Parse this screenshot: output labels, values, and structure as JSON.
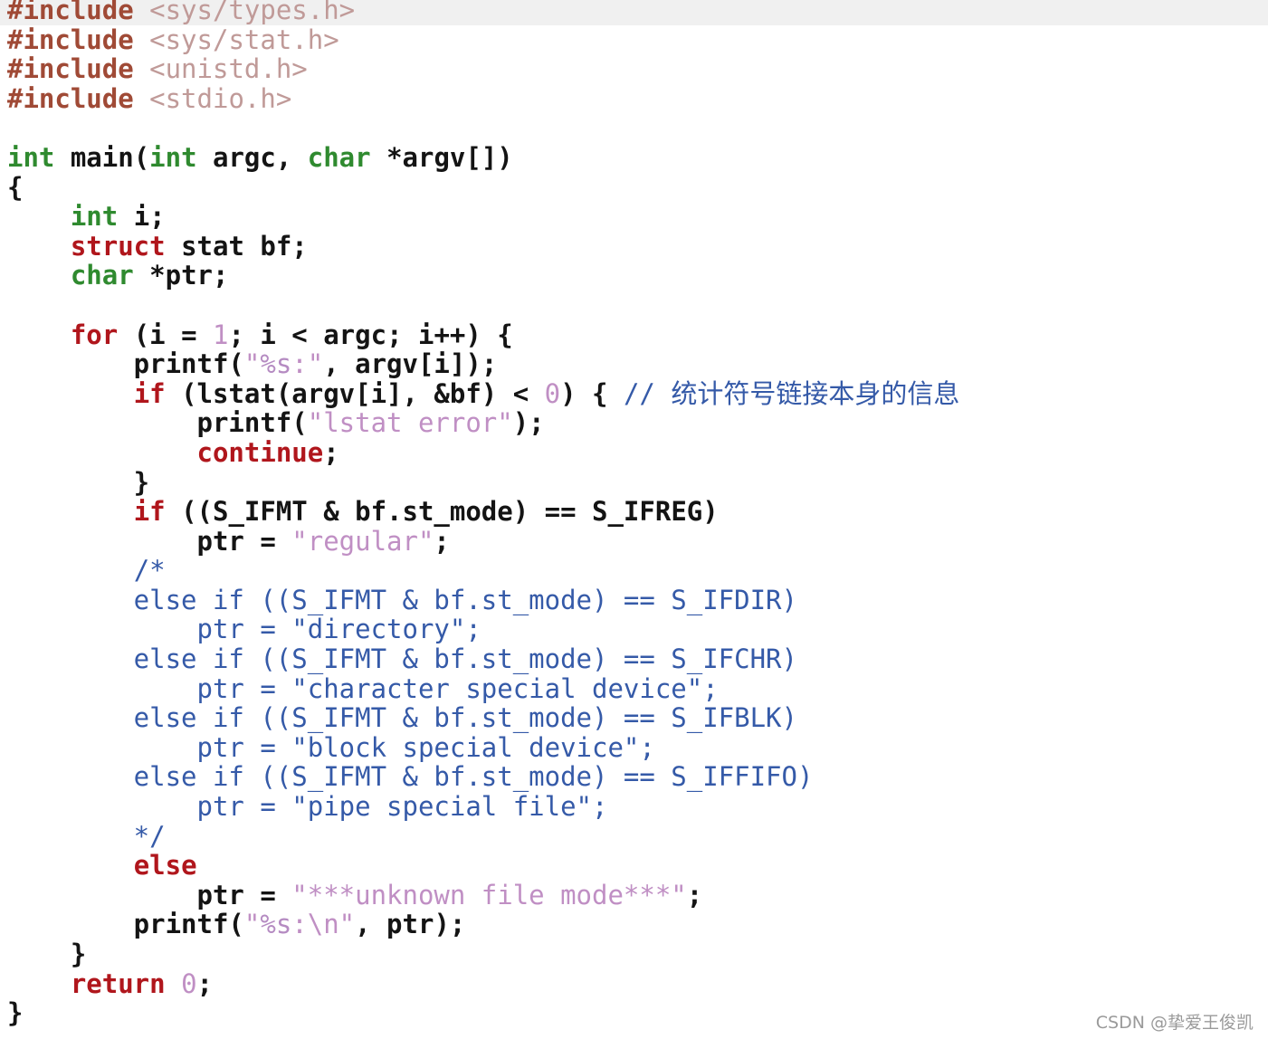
{
  "editor": {
    "language": "C",
    "current_line": 1,
    "colors": {
      "background": "#ffffff",
      "current_line": "#f0f0f0",
      "default": "#141414",
      "preprocessor": "#a04a36",
      "include_path": "#c09a98",
      "type": "#2f8a2f",
      "keyword": "#b0161c",
      "string": "#c08fc4",
      "number": "#c08fc4",
      "comment": "#355aa8"
    },
    "lines": [
      [
        {
          "t": "#include ",
          "c": "pre"
        },
        {
          "t": "<sys/types.h>",
          "c": "inc"
        }
      ],
      [
        {
          "t": "#include ",
          "c": "pre"
        },
        {
          "t": "<sys/stat.h>",
          "c": "inc"
        }
      ],
      [
        {
          "t": "#include ",
          "c": "pre"
        },
        {
          "t": "<unistd.h>",
          "c": "inc"
        }
      ],
      [
        {
          "t": "#include ",
          "c": "pre"
        },
        {
          "t": "<stdio.h>",
          "c": "inc"
        }
      ],
      [],
      [
        {
          "t": "int",
          "c": "type"
        },
        {
          "t": " main("
        },
        {
          "t": "int",
          "c": "type"
        },
        {
          "t": " argc, "
        },
        {
          "t": "char",
          "c": "type"
        },
        {
          "t": " *argv[])"
        }
      ],
      [
        {
          "t": "{"
        }
      ],
      [
        {
          "t": "    "
        },
        {
          "t": "int",
          "c": "type"
        },
        {
          "t": " i;"
        }
      ],
      [
        {
          "t": "    "
        },
        {
          "t": "struct",
          "c": "kw"
        },
        {
          "t": " stat bf;"
        }
      ],
      [
        {
          "t": "    "
        },
        {
          "t": "char",
          "c": "type"
        },
        {
          "t": " *ptr;"
        }
      ],
      [],
      [
        {
          "t": "    "
        },
        {
          "t": "for",
          "c": "kw"
        },
        {
          "t": " (i = "
        },
        {
          "t": "1",
          "c": "num"
        },
        {
          "t": "; i < argc; i++) {"
        }
      ],
      [
        {
          "t": "        printf("
        },
        {
          "t": "\"",
          "c": "str"
        },
        {
          "t": "%s",
          "c": "fmt"
        },
        {
          "t": ":\"",
          "c": "str"
        },
        {
          "t": ", argv[i]);"
        }
      ],
      [
        {
          "t": "        "
        },
        {
          "t": "if",
          "c": "kw"
        },
        {
          "t": " (lstat(argv[i], &bf) < "
        },
        {
          "t": "0",
          "c": "num"
        },
        {
          "t": ") { "
        },
        {
          "t": "// ",
          "c": "cmt"
        },
        {
          "t": "统计符号链接本身的信息",
          "c": "cjk"
        }
      ],
      [
        {
          "t": "            printf("
        },
        {
          "t": "\"lstat error\"",
          "c": "str"
        },
        {
          "t": ");"
        }
      ],
      [
        {
          "t": "            "
        },
        {
          "t": "continue",
          "c": "kw"
        },
        {
          "t": ";"
        }
      ],
      [
        {
          "t": "        }"
        }
      ],
      [
        {
          "t": "        "
        },
        {
          "t": "if",
          "c": "kw"
        },
        {
          "t": " ((S_IFMT & bf.st_mode) == S_IFREG)"
        }
      ],
      [
        {
          "t": "            ptr = "
        },
        {
          "t": "\"regular\"",
          "c": "str"
        },
        {
          "t": ";"
        }
      ],
      [
        {
          "t": "        "
        },
        {
          "t": "/*",
          "c": "cmt"
        }
      ],
      [
        {
          "t": "        else if ((S_IFMT & bf.st_mode) == S_IFDIR)",
          "c": "cmt"
        }
      ],
      [
        {
          "t": "            ptr = \"directory\";",
          "c": "cmt"
        }
      ],
      [
        {
          "t": "        else if ((S_IFMT & bf.st_mode) == S_IFCHR)",
          "c": "cmt"
        }
      ],
      [
        {
          "t": "            ptr = \"character special device\";",
          "c": "cmt"
        }
      ],
      [
        {
          "t": "        else if ((S_IFMT & bf.st_mode) == S_IFBLK)",
          "c": "cmt"
        }
      ],
      [
        {
          "t": "            ptr = \"block special device\";",
          "c": "cmt"
        }
      ],
      [
        {
          "t": "        else if ((S_IFMT & bf.st_mode) == S_IFFIFO)",
          "c": "cmt"
        }
      ],
      [
        {
          "t": "            ptr = \"pipe special file\";",
          "c": "cmt"
        }
      ],
      [
        {
          "t": "        */",
          "c": "cmt"
        }
      ],
      [
        {
          "t": "        "
        },
        {
          "t": "else",
          "c": "kw"
        }
      ],
      [
        {
          "t": "            ptr = "
        },
        {
          "t": "\"***unknown file mode***\"",
          "c": "str"
        },
        {
          "t": ";"
        }
      ],
      [
        {
          "t": "        printf("
        },
        {
          "t": "\"",
          "c": "str"
        },
        {
          "t": "%s",
          "c": "fmt"
        },
        {
          "t": ":\\n\"",
          "c": "str"
        },
        {
          "t": ", ptr);"
        }
      ],
      [
        {
          "t": "    }"
        }
      ],
      [
        {
          "t": "    "
        },
        {
          "t": "return",
          "c": "kw"
        },
        {
          "t": " "
        },
        {
          "t": "0",
          "c": "num"
        },
        {
          "t": ";"
        }
      ],
      [
        {
          "t": "}"
        }
      ]
    ]
  },
  "watermark": {
    "text": "CSDN @挚爱王俊凯"
  }
}
